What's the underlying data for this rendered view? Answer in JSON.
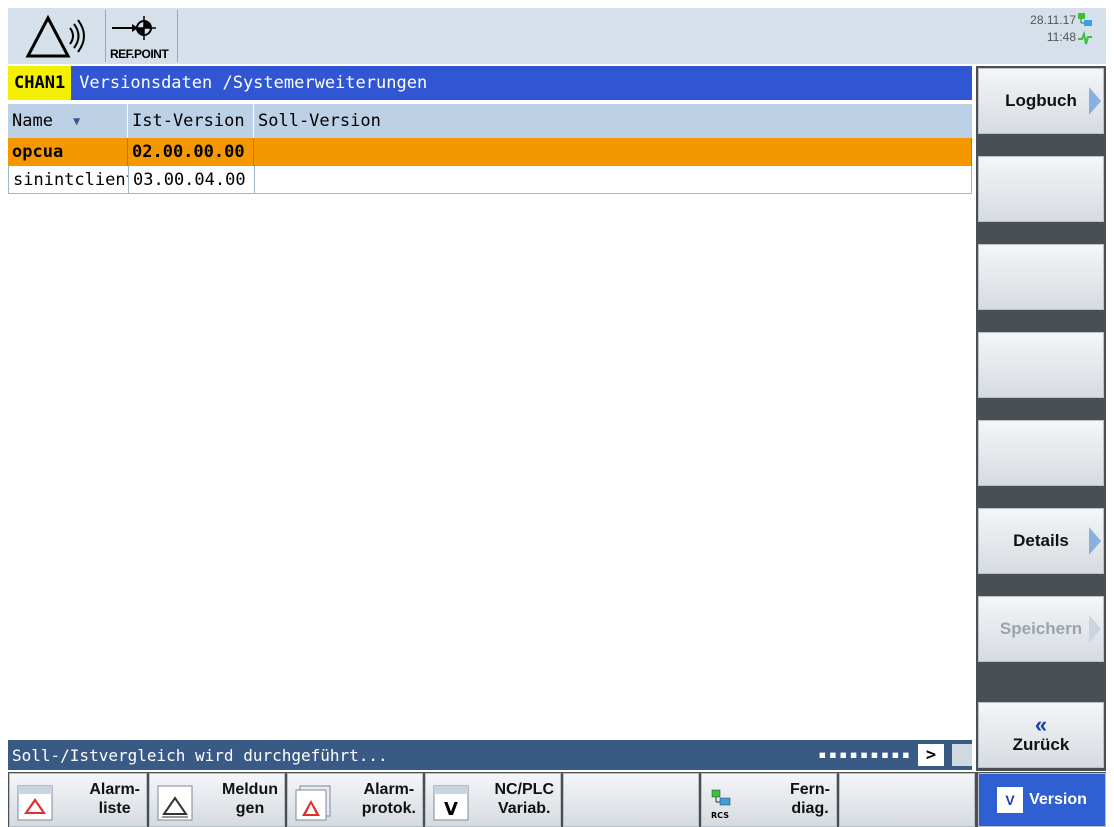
{
  "header": {
    "refpoint_label": "REF.POINT",
    "date": "28.11.17",
    "time": "11:48"
  },
  "titlebar": {
    "channel": "CHAN1",
    "title": "Versionsdaten /Systemerweiterungen"
  },
  "table": {
    "columns": [
      "Name",
      "Ist-Version",
      "Soll-Version"
    ],
    "rows": [
      {
        "name": "opcua",
        "ist": "02.00.00.00",
        "soll": ""
      },
      {
        "name": "sinintclient",
        "ist": "03.00.04.00",
        "soll": ""
      }
    ]
  },
  "statusbar": {
    "text": "Soll-/Istvergleich wird durchgeführt...",
    "dots": "▪▪▪▪▪▪▪▪▪",
    "scroll_label": ">"
  },
  "vertical_softkeys": {
    "logbuch": "Logbuch",
    "details": "Details",
    "speichern": "Speichern",
    "back_chevron": "«",
    "zurueck": "Zurück"
  },
  "horizontal_softkeys": {
    "alarmliste_1": "Alarm-",
    "alarmliste_2": "liste",
    "meldungen_1": "Meldun",
    "meldungen_2": "gen",
    "alarmprotok_1": "Alarm-",
    "alarmprotok_2": "protok.",
    "ncplc_1": "NC/PLC",
    "ncplc_2": "Variab.",
    "ferndiag_1": "Fern-",
    "ferndiag_2": "diag.",
    "rcs_label": "RCS",
    "version": "Version",
    "version_icon_text": "V"
  },
  "colors": {
    "title_blue": "#3056d4",
    "channel_yellow": "#f5ef00",
    "selected_row": "#f59800",
    "header_row": "#bcd0e6",
    "status_bar": "#3a5a86",
    "active_softkey": "#2f5fd0"
  }
}
